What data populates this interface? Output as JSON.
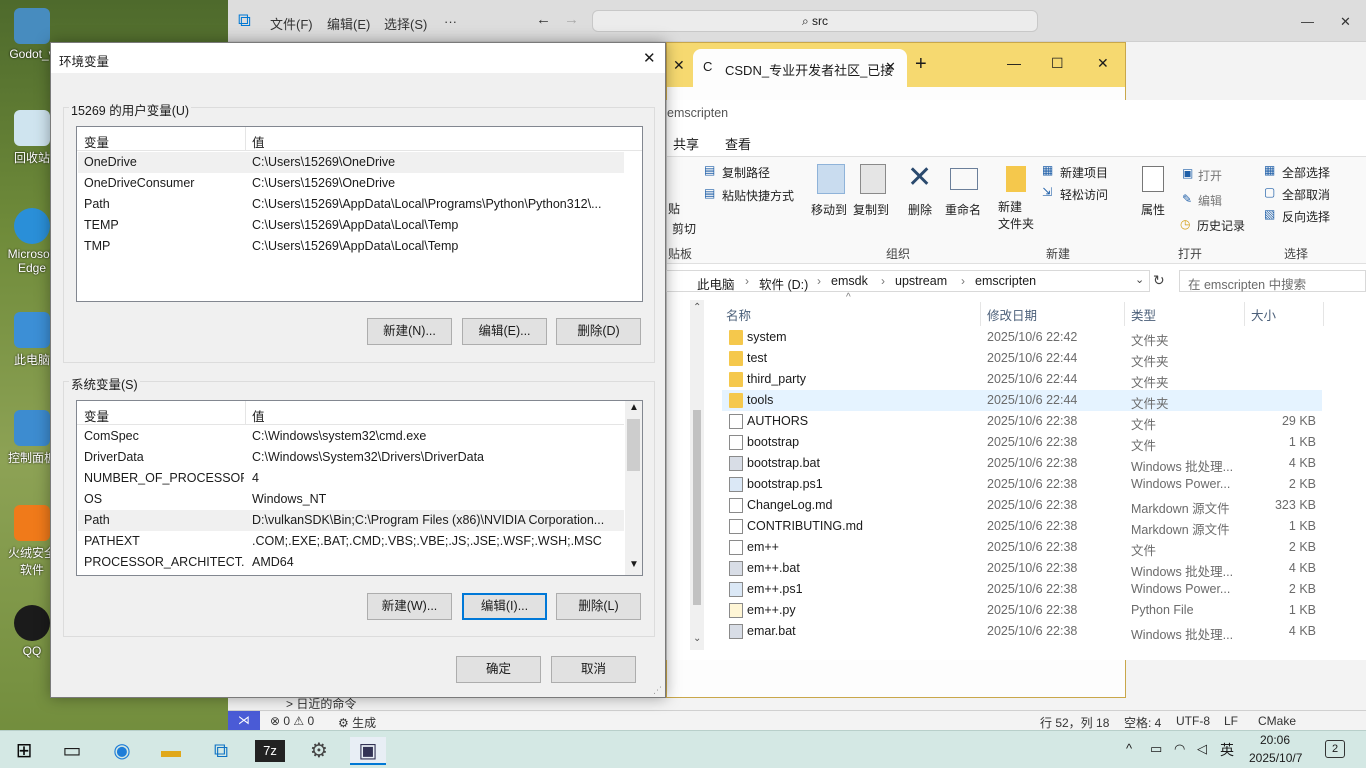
{
  "desktop": {
    "icons": [
      {
        "label": "Godot_v"
      },
      {
        "label": "回收站"
      },
      {
        "label": "Microsoft Edge"
      },
      {
        "label": "此电脑"
      },
      {
        "label": "控制面板"
      },
      {
        "label": "火绒安全软件"
      },
      {
        "label": "QQ"
      }
    ]
  },
  "vscode": {
    "menu": [
      "文件(F)",
      "编辑(E)",
      "选择(S)",
      "···"
    ],
    "search": "src",
    "status": {
      "errors": "⊗ 0 ⚠ 0",
      "build": "⚙ 生成",
      "position": "行 52，列 18",
      "spaces": "空格: 4",
      "encoding": "UTF-8",
      "eol": "LF",
      "lang": "CMake",
      "hint": "> 日近的命令"
    }
  },
  "chrome": {
    "tab_title": "CSDN_专业开发者社区_已接",
    "new_tab": "+",
    "controls": [
      "—",
      "☐",
      "✕"
    ]
  },
  "explorer": {
    "title": "emscripten",
    "ribbon_tabs": [
      "共享",
      "查看"
    ],
    "ribbon": {
      "copy_path": "复制路径",
      "paste_shortcut": "粘贴快捷方式",
      "paste": "贴",
      "cut": "剪切",
      "clipboard": "贴板",
      "move_to": "移动到",
      "copy_to": "复制到",
      "delete": "删除",
      "rename": "重命名",
      "organize": "组织",
      "new_folder": "新建\n文件夹",
      "new_item": "新建项目",
      "easy_access": "轻松访问",
      "new_group": "新建",
      "properties": "属性",
      "open": "打开",
      "edit": "编辑",
      "history": "历史记录",
      "open_group": "打开",
      "select_all": "全部选择",
      "select_none": "全部取消",
      "invert": "反向选择",
      "select_group": "选择"
    },
    "breadcrumb": [
      "此电脑",
      "软件 (D:)",
      "emsdk",
      "upstream",
      "emscripten"
    ],
    "search_placeholder": "在 emscripten 中搜索",
    "columns": {
      "name": "名称",
      "date": "修改日期",
      "type": "类型",
      "size": "大小"
    },
    "files": [
      {
        "name": "system",
        "date": "2025/10/6 22:42",
        "type": "文件夹",
        "size": "",
        "kind": "folder"
      },
      {
        "name": "test",
        "date": "2025/10/6 22:44",
        "type": "文件夹",
        "size": "",
        "kind": "folder"
      },
      {
        "name": "third_party",
        "date": "2025/10/6 22:44",
        "type": "文件夹",
        "size": "",
        "kind": "folder"
      },
      {
        "name": "tools",
        "date": "2025/10/6 22:44",
        "type": "文件夹",
        "size": "",
        "kind": "folder"
      },
      {
        "name": "AUTHORS",
        "date": "2025/10/6 22:38",
        "type": "文件",
        "size": "29 KB",
        "kind": "file"
      },
      {
        "name": "bootstrap",
        "date": "2025/10/6 22:38",
        "type": "文件",
        "size": "1 KB",
        "kind": "file"
      },
      {
        "name": "bootstrap.bat",
        "date": "2025/10/6 22:38",
        "type": "Windows 批处理...",
        "size": "4 KB",
        "kind": "file"
      },
      {
        "name": "bootstrap.ps1",
        "date": "2025/10/6 22:38",
        "type": "Windows Power...",
        "size": "2 KB",
        "kind": "file"
      },
      {
        "name": "ChangeLog.md",
        "date": "2025/10/6 22:38",
        "type": "Markdown 源文件",
        "size": "323 KB",
        "kind": "file"
      },
      {
        "name": "CONTRIBUTING.md",
        "date": "2025/10/6 22:38",
        "type": "Markdown 源文件",
        "size": "1 KB",
        "kind": "file"
      },
      {
        "name": "em++",
        "date": "2025/10/6 22:38",
        "type": "文件",
        "size": "2 KB",
        "kind": "file"
      },
      {
        "name": "em++.bat",
        "date": "2025/10/6 22:38",
        "type": "Windows 批处理...",
        "size": "4 KB",
        "kind": "file"
      },
      {
        "name": "em++.ps1",
        "date": "2025/10/6 22:38",
        "type": "Windows Power...",
        "size": "2 KB",
        "kind": "file"
      },
      {
        "name": "em++.py",
        "date": "2025/10/6 22:38",
        "type": "Python File",
        "size": "1 KB",
        "kind": "file"
      },
      {
        "name": "emar.bat",
        "date": "2025/10/6 22:38",
        "type": "Windows 批处理...",
        "size": "4 KB",
        "kind": "file"
      }
    ]
  },
  "env_dialog": {
    "title": "环境变量",
    "close": "✕",
    "user_group": "15269 的用户变量(U)",
    "col_var": "变量",
    "col_val": "值",
    "user_vars": [
      {
        "k": "OneDrive",
        "v": "C:\\Users\\15269\\OneDrive"
      },
      {
        "k": "OneDriveConsumer",
        "v": "C:\\Users\\15269\\OneDrive"
      },
      {
        "k": "Path",
        "v": "C:\\Users\\15269\\AppData\\Local\\Programs\\Python\\Python312\\..."
      },
      {
        "k": "TEMP",
        "v": "C:\\Users\\15269\\AppData\\Local\\Temp"
      },
      {
        "k": "TMP",
        "v": "C:\\Users\\15269\\AppData\\Local\\Temp"
      }
    ],
    "user_buttons": {
      "new": "新建(N)...",
      "edit": "编辑(E)...",
      "delete": "删除(D)"
    },
    "sys_group": "系统变量(S)",
    "sys_vars": [
      {
        "k": "ComSpec",
        "v": "C:\\Windows\\system32\\cmd.exe"
      },
      {
        "k": "DriverData",
        "v": "C:\\Windows\\System32\\Drivers\\DriverData"
      },
      {
        "k": "NUMBER_OF_PROCESSORS",
        "v": "4"
      },
      {
        "k": "OS",
        "v": "Windows_NT"
      },
      {
        "k": "Path",
        "v": "D:\\vulkanSDK\\Bin;C:\\Program Files (x86)\\NVIDIA Corporation..."
      },
      {
        "k": "PATHEXT",
        "v": ".COM;.EXE;.BAT;.CMD;.VBS;.VBE;.JS;.JSE;.WSF;.WSH;.MSC"
      },
      {
        "k": "PROCESSOR_ARCHITECT...",
        "v": "AMD64"
      }
    ],
    "sys_buttons": {
      "new": "新建(W)...",
      "edit": "编辑(I)...",
      "delete": "删除(L)"
    },
    "ok": "确定",
    "cancel": "取消"
  },
  "taskbar": {
    "ime": "英",
    "time": "20:06",
    "date": "2025/10/7",
    "notifications": "2"
  }
}
